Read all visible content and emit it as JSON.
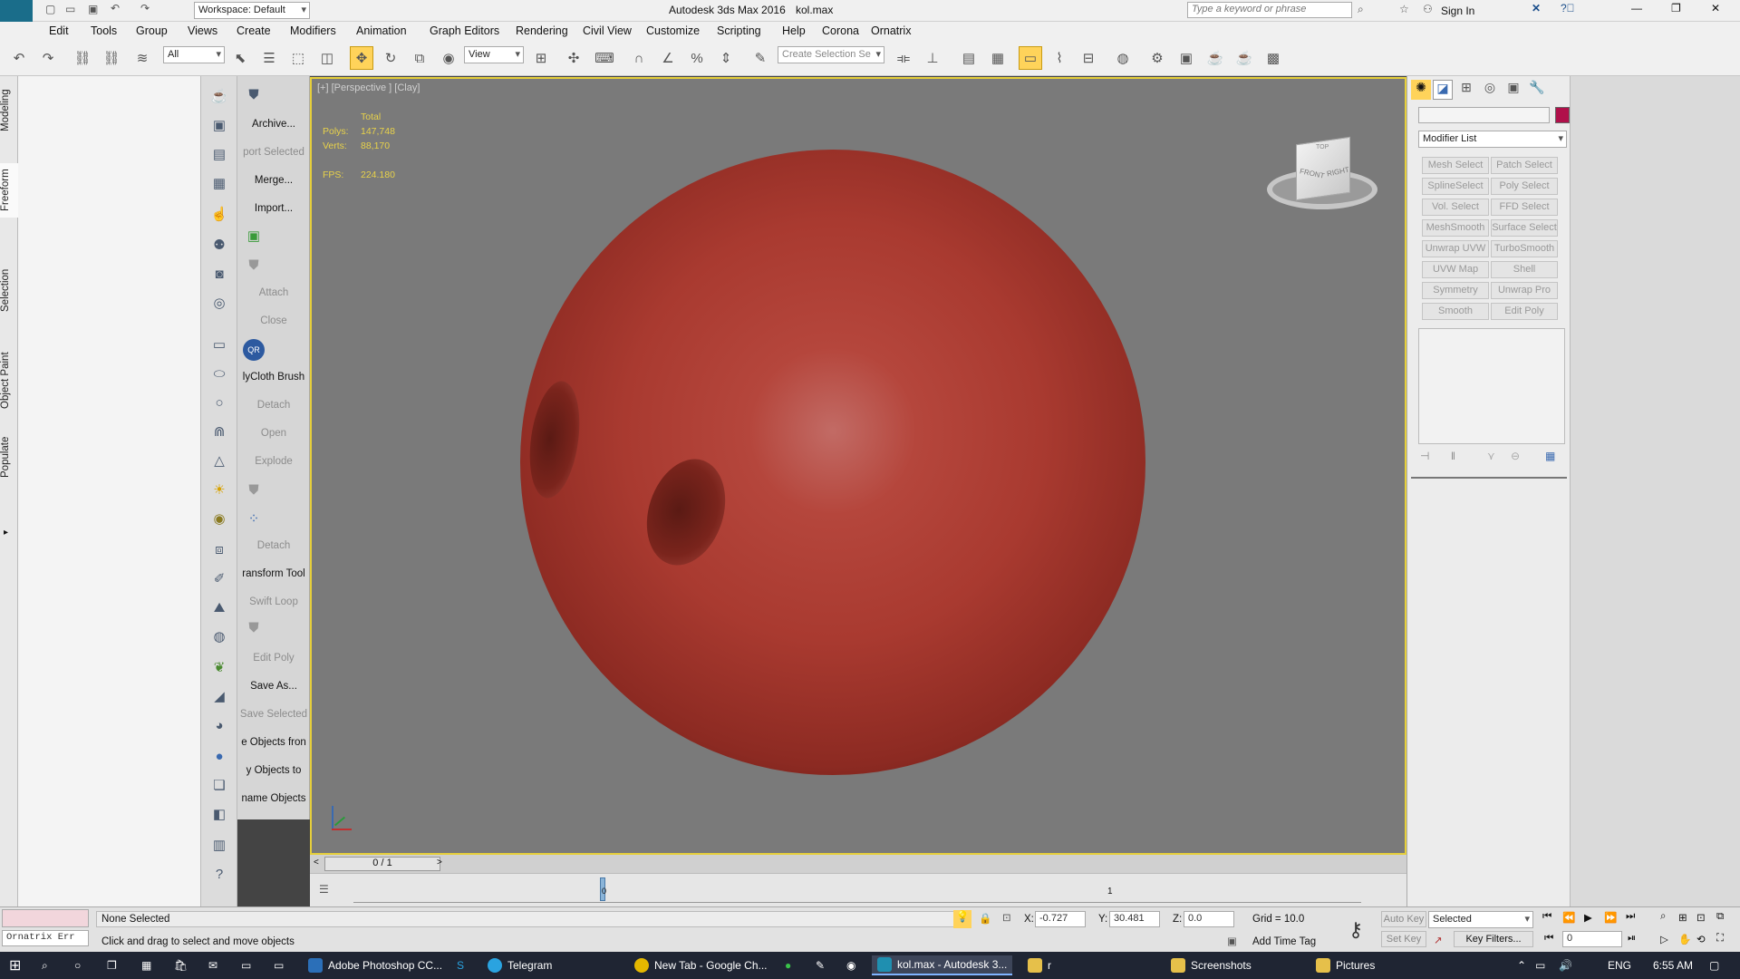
{
  "titlebar": {
    "workspace": "Workspace: Default",
    "title": "Autodesk 3ds Max 2016",
    "file": "kol.max",
    "search_placeholder": "Type a keyword or phrase",
    "sign_in": "Sign In",
    "app_logo": "MAX"
  },
  "menu": [
    "Edit",
    "Tools",
    "Group",
    "Views",
    "Create",
    "Modifiers",
    "Animation",
    "Graph Editors",
    "Rendering",
    "Civil View",
    "Customize",
    "Scripting",
    "Help",
    "Corona",
    "Ornatrix"
  ],
  "toolbar": {
    "selection_filter": "All",
    "ref_coord": "View",
    "named_selection_placeholder": "Create Selection Se"
  },
  "ribbon_tabs": [
    "Modeling",
    "Freeform",
    "Selection",
    "Object Paint",
    "Populate"
  ],
  "command_panel": [
    {
      "label": "Archive...",
      "enabled": true
    },
    {
      "label": "port Selected",
      "enabled": false
    },
    {
      "label": "Merge...",
      "enabled": true
    },
    {
      "label": "Import...",
      "enabled": true
    },
    {
      "label": "Attach",
      "enabled": false
    },
    {
      "label": "Close",
      "enabled": false
    },
    {
      "label": "lyCloth Brush",
      "enabled": true
    },
    {
      "label": "Detach",
      "enabled": false
    },
    {
      "label": "Open",
      "enabled": false
    },
    {
      "label": "Explode",
      "enabled": false
    },
    {
      "label": "Detach",
      "enabled": false
    },
    {
      "label": "ransform Tool",
      "enabled": true
    },
    {
      "label": "Swift Loop",
      "enabled": false
    },
    {
      "label": "Edit Poly",
      "enabled": false
    },
    {
      "label": "Save As...",
      "enabled": true
    },
    {
      "label": "Save Selected",
      "enabled": false
    },
    {
      "label": "e Objects fron",
      "enabled": true
    },
    {
      "label": "y Objects to",
      "enabled": true
    },
    {
      "label": "name Objects",
      "enabled": true
    }
  ],
  "viewport": {
    "label": "[+] [Perspective ] [Clay]",
    "stats": {
      "total_label": "Total",
      "polys_label": "Polys:",
      "polys": "147,748",
      "verts_label": "Verts:",
      "verts": "88,170",
      "fps_label": "FPS:",
      "fps": "224.180"
    },
    "viewcube": {
      "front": "FRONT",
      "right": "RIGHT",
      "top": "TOP"
    },
    "colors": {
      "border": "#e6cf3b",
      "ball": "#a93a30"
    }
  },
  "modifier_panel": {
    "modifier_list": "Modifier List",
    "buttons": [
      "Mesh Select",
      "Patch Select",
      "SplineSelect",
      "Poly Select",
      "Vol. Select",
      "FFD Select",
      "MeshSmooth",
      "Surface Select",
      "Unwrap UVW",
      "TurboSmooth",
      "UVW Map",
      "Shell",
      "Symmetry",
      "Unwrap Pro",
      "Smooth",
      "Edit Poly"
    ]
  },
  "timeline": {
    "frame": "0 / 1",
    "tick_1": "1",
    "tick_0": "0"
  },
  "status": {
    "script_listener": "Ornatrix Err",
    "selection": "None Selected",
    "prompt": "Click and drag to select and move objects",
    "x_label": "X:",
    "x": "-0.727",
    "y_label": "Y:",
    "y": "30.481",
    "z_label": "Z:",
    "z": "0.0",
    "grid": "Grid = 10.0",
    "add_time_tag": "Add Time Tag",
    "auto_key": "Auto Key",
    "set_key": "Set Key",
    "selected": "Selected",
    "key_filters": "Key Filters...",
    "frame_field": "0"
  },
  "taskbar": {
    "items": [
      {
        "label": "Adobe Photoshop CC...",
        "color": "#2b6fb8"
      },
      {
        "label": "Telegram",
        "color": "#2aa3e0"
      },
      {
        "label": "New Tab - Google Ch...",
        "color": "#e4b800"
      },
      {
        "label": "kol.max - Autodesk 3...",
        "color": "#1f8fb0"
      },
      {
        "label": "r",
        "color": "#e6c04a"
      },
      {
        "label": "Screenshots",
        "color": "#e6c04a"
      },
      {
        "label": "Pictures",
        "color": "#e6c04a"
      }
    ],
    "lang": "ENG",
    "time": "6:55 AM"
  }
}
